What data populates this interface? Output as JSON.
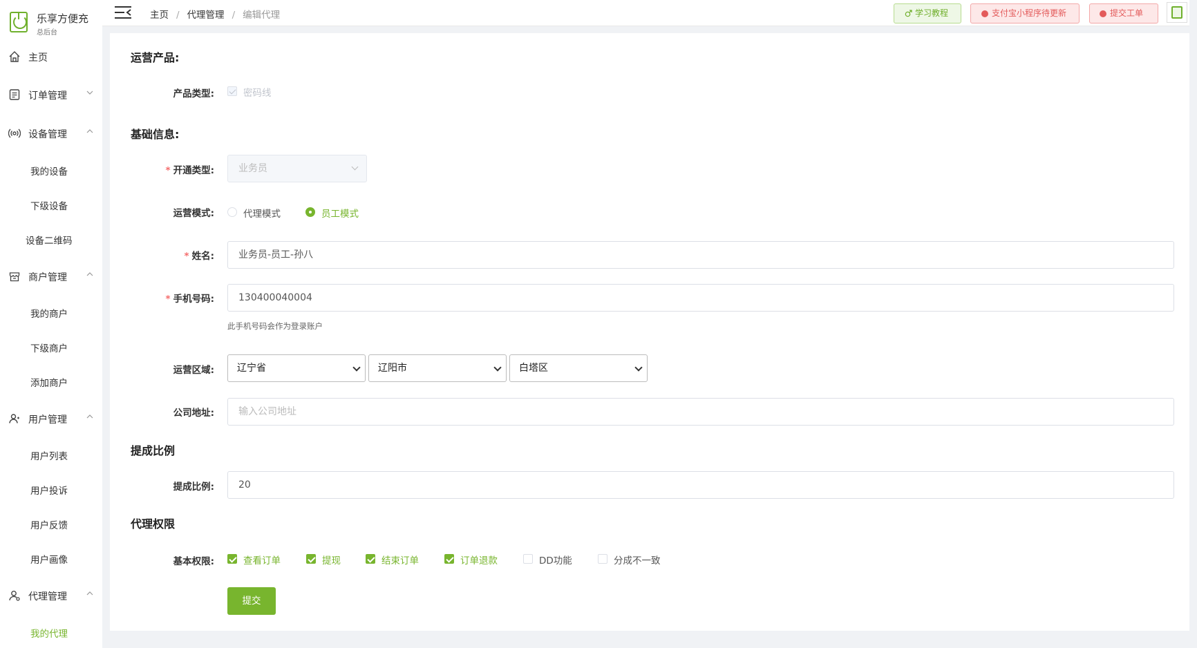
{
  "app": {
    "title": "乐享方便充",
    "subtitle": "总后台"
  },
  "sidebar": {
    "items": [
      {
        "label": "主页",
        "icon": "home-icon"
      },
      {
        "label": "订单管理",
        "icon": "order-icon",
        "expanded": false
      },
      {
        "label": "设备管理",
        "icon": "device-icon",
        "expanded": true,
        "children": [
          "我的设备",
          "下级设备",
          "设备二维码"
        ]
      },
      {
        "label": "商户管理",
        "icon": "shop-icon",
        "expanded": true,
        "children": [
          "我的商户",
          "下级商户",
          "添加商户"
        ]
      },
      {
        "label": "用户管理",
        "icon": "user-icon",
        "expanded": true,
        "children": [
          "用户列表",
          "用户投诉",
          "用户反馈",
          "用户画像"
        ]
      },
      {
        "label": "代理管理",
        "icon": "agent-icon",
        "expanded": true,
        "children": [
          "我的代理"
        ],
        "active_child": "我的代理"
      }
    ]
  },
  "header": {
    "breadcrumb": [
      "主页",
      "代理管理",
      "编辑代理"
    ],
    "buttons": {
      "tutorial": "学习教程",
      "alipay": "支付宝小程序待更新",
      "ticket": "提交工单"
    }
  },
  "form": {
    "sections": {
      "product": "运营产品:",
      "basic": "基础信息:",
      "commission": "提成比例",
      "permissions": "代理权限"
    },
    "product_type": {
      "label": "产品类型:",
      "option": "密码线",
      "checked": true,
      "disabled": true
    },
    "open_type": {
      "label": "开通类型:",
      "value": "业务员",
      "required": true
    },
    "mode": {
      "label": "运营模式:",
      "options": [
        "代理模式",
        "员工模式"
      ],
      "selected": "员工模式"
    },
    "name": {
      "label": "姓名:",
      "value": "业务员-员工-孙八",
      "required": true
    },
    "phone": {
      "label": "手机号码:",
      "value": "130400040004",
      "required": true,
      "hint": "此手机号码会作为登录账户"
    },
    "region": {
      "label": "运营区域:",
      "province": "辽宁省",
      "city": "辽阳市",
      "district": "白塔区"
    },
    "address": {
      "label": "公司地址:",
      "placeholder": "输入公司地址",
      "value": ""
    },
    "rate": {
      "label": "提成比例:",
      "value": "20"
    },
    "perms": {
      "label": "基本权限:",
      "items": [
        {
          "label": "查看订单",
          "checked": true
        },
        {
          "label": "提现",
          "checked": true
        },
        {
          "label": "结束订单",
          "checked": true
        },
        {
          "label": "订单退款",
          "checked": true
        },
        {
          "label": "DD功能",
          "checked": false
        },
        {
          "label": "分成不一致",
          "checked": false
        }
      ]
    },
    "submit": "提交"
  },
  "colors": {
    "accent": "#78b52e",
    "danger": "#e35a5a",
    "required": "#f56c6c"
  }
}
